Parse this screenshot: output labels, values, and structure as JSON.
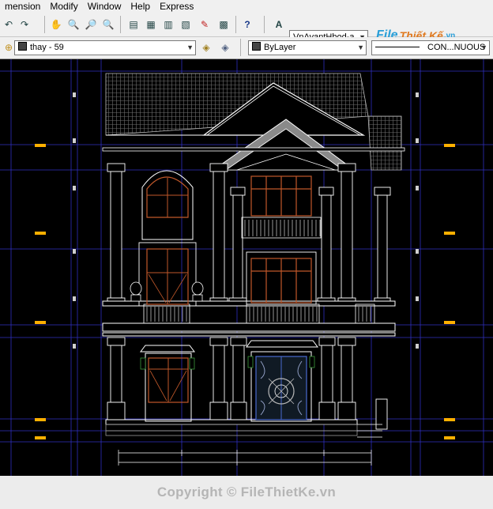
{
  "menu": {
    "items": [
      "mension",
      "Modify",
      "Window",
      "Help",
      "Express"
    ]
  },
  "toolbar": {
    "text_style": "VnAvantHbod-a",
    "layer_name": "thay - 59",
    "color": "ByLayer",
    "linetype": "CON...NUOUS"
  },
  "logo": {
    "part1": "File",
    "part2": "Thiết Kế",
    "part3": ".vn"
  },
  "footer": {
    "copyright": "Copyright © FileThietKe.vn"
  },
  "colors": {
    "canvas_bg": "#000000",
    "wall_line": "#ffffff",
    "window_frame": "#c0582a",
    "grid_line": "#3a3ad0",
    "marker": "#ffb000",
    "roof_hatch": "#8a8a8a"
  },
  "icons": [
    "undo-icon",
    "redo-icon",
    "pan-icon",
    "zoom-realtime-icon",
    "zoom-window-icon",
    "zoom-previous-icon",
    "properties-icon",
    "design-center-icon",
    "tool-palettes-icon",
    "sheet-set-icon",
    "markup-icon",
    "calculator-icon",
    "help-icon",
    "text-style-icon",
    "layer-states-icon",
    "layer-previous-icon"
  ]
}
